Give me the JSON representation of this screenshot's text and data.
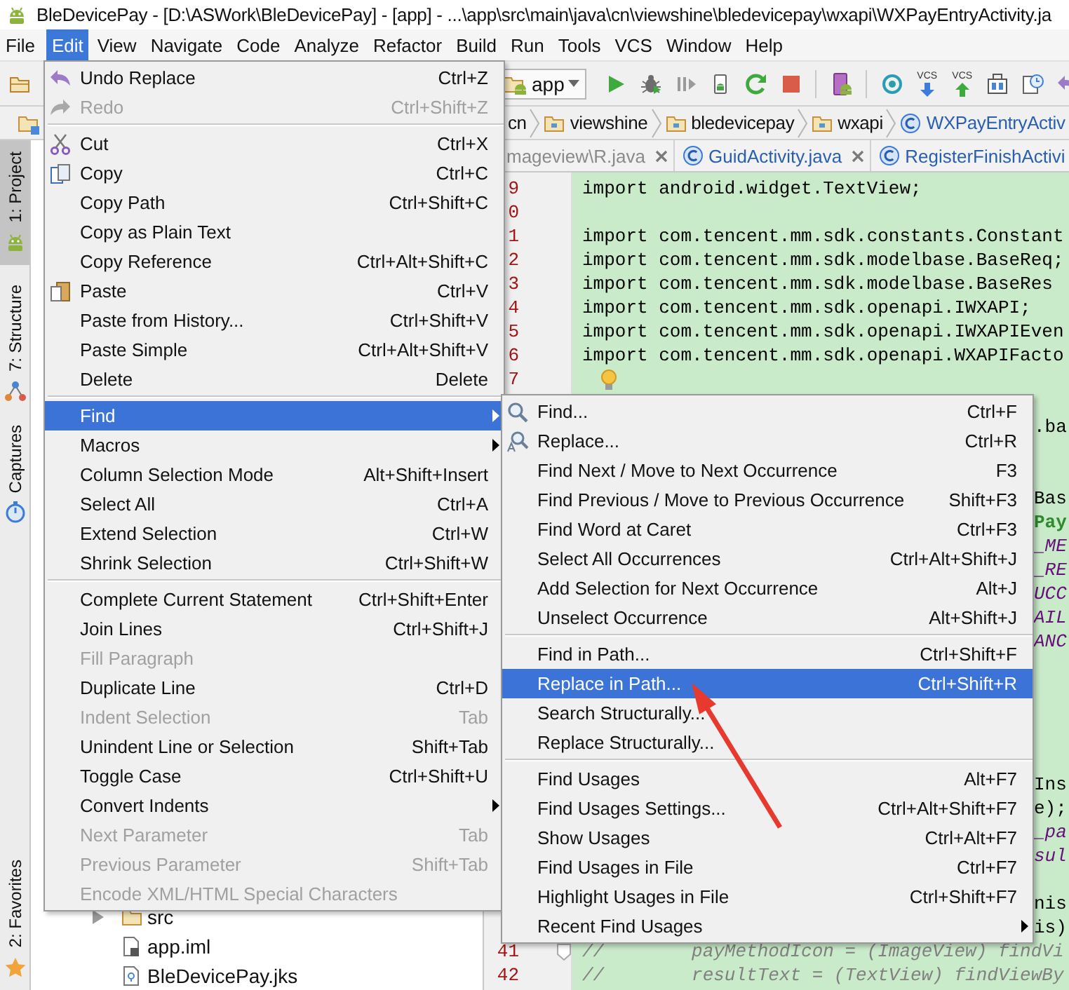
{
  "window": {
    "title": "BleDevicePay - [D:\\ASWork\\BleDevicePay] - [app] - ...\\app\\src\\main\\java\\cn\\viewshine\\bledevicepay\\wxapi\\WXPayEntryActivity.ja"
  },
  "menu_bar": [
    {
      "label": "File",
      "selected": false
    },
    {
      "label": "Edit",
      "selected": true
    },
    {
      "label": "View",
      "selected": false
    },
    {
      "label": "Navigate",
      "selected": false
    },
    {
      "label": "Code",
      "selected": false
    },
    {
      "label": "Analyze",
      "selected": false
    },
    {
      "label": "Refactor",
      "selected": false
    },
    {
      "label": "Build",
      "selected": false
    },
    {
      "label": "Run",
      "selected": false
    },
    {
      "label": "Tools",
      "selected": false
    },
    {
      "label": "VCS",
      "selected": false
    },
    {
      "label": "Window",
      "selected": false
    },
    {
      "label": "Help",
      "selected": false
    }
  ],
  "toolbar": {
    "run_config": "app",
    "buttons": [
      {
        "kind": "run"
      },
      {
        "kind": "debug"
      },
      {
        "kind": "attach"
      },
      {
        "kind": "apply"
      },
      {
        "kind": "rerun"
      },
      {
        "kind": "stop"
      },
      {
        "kind": "separator"
      },
      {
        "kind": "avd"
      },
      {
        "kind": "separator"
      },
      {
        "kind": "sdk"
      },
      {
        "kind": "vcs-update",
        "caption": "VCS"
      },
      {
        "kind": "vcs-commit",
        "caption": "VCS"
      },
      {
        "kind": "compare"
      },
      {
        "kind": "history"
      },
      {
        "kind": "undo"
      }
    ]
  },
  "navigation_bar": [
    {
      "label": "cn",
      "kind": "package"
    },
    {
      "label": "viewshine",
      "kind": "package"
    },
    {
      "label": "bledevicepay",
      "kind": "package"
    },
    {
      "label": "wxapi",
      "kind": "package"
    },
    {
      "label": "WXPayEntryActiv",
      "kind": "class"
    }
  ],
  "editor_tabs": [
    {
      "label": "mageview\\R.java",
      "kind": "generated",
      "closable": true
    },
    {
      "label": "GuidActivity.java",
      "kind": "class",
      "closable": true
    },
    {
      "label": "RegisterFinishActivi",
      "kind": "class",
      "closable": false
    }
  ],
  "tool_windows": [
    {
      "label": "1: Project",
      "kind": "android",
      "selected": true
    },
    {
      "label": "7: Structure",
      "kind": "structure",
      "selected": false
    },
    {
      "label": "Captures",
      "kind": "captures",
      "selected": false
    },
    {
      "label": "2: Favorites",
      "kind": "star",
      "selected": false
    }
  ],
  "project_tree": [
    {
      "label": "src",
      "kind": "folder",
      "expanded": false
    },
    {
      "label": "app.iml",
      "kind": "module-file"
    },
    {
      "label": "BleDevicePay.jks",
      "kind": "keystore"
    }
  ],
  "editor": {
    "lines": [
      {
        "kind": "code",
        "number": "9",
        "code": "import android.widget.TextView;"
      },
      {
        "kind": "code",
        "number": "0"
      },
      {
        "kind": "code",
        "number": "1",
        "code": "import com.tencent.mm.sdk.constants.Constant"
      },
      {
        "kind": "code",
        "number": "2",
        "code": "import com.tencent.mm.sdk.modelbase.BaseReq;"
      },
      {
        "kind": "code",
        "number": "3",
        "code": "import com.tencent.mm.sdk.modelbase.BaseRes"
      },
      {
        "kind": "code",
        "number": "4",
        "code": "import com.tencent.mm.sdk.openapi.IWXAPI;"
      },
      {
        "kind": "code",
        "number": "5",
        "code": "import com.tencent.mm.sdk.openapi.IWXAPIEven"
      },
      {
        "kind": "code",
        "number": "6",
        "code": "import com.tencent.mm.sdk.openapi.WXAPIFacto"
      },
      {
        "kind": "code",
        "number": "7",
        "bulb": true
      },
      {
        "kind": "hidden"
      },
      {
        "kind": "plain",
        "code": ".ba"
      },
      {
        "kind": "hidden"
      },
      {
        "kind": "hidden"
      },
      {
        "kind": "plain",
        "code": "Bas"
      },
      {
        "kind": "string",
        "code": "Pay"
      },
      {
        "kind": "constant",
        "code": "_ME"
      },
      {
        "kind": "constant",
        "code": "_RE"
      },
      {
        "kind": "constant",
        "code": "UCC"
      },
      {
        "kind": "constant",
        "code": "AIL"
      },
      {
        "kind": "constant",
        "code": "ANC"
      },
      {
        "kind": "hidden"
      },
      {
        "kind": "hidden"
      },
      {
        "kind": "hidden"
      },
      {
        "kind": "hidden"
      },
      {
        "kind": "hidden"
      },
      {
        "kind": "plain",
        "code": "Ins"
      },
      {
        "kind": "plain",
        "code": "e);"
      },
      {
        "kind": "constant",
        "code": "_pa"
      },
      {
        "kind": "constant",
        "code": "sul"
      },
      {
        "kind": "hidden"
      },
      {
        "kind": "plain",
        "code": "nis"
      },
      {
        "kind": "plain",
        "code": "is)"
      },
      {
        "kind": "comment",
        "number": "41",
        "code": "//        payMethodIcon = (ImageView) findVi",
        "fold": true
      },
      {
        "kind": "comment",
        "number": "42",
        "code": "//        resultText = (TextView) findViewBy"
      }
    ]
  },
  "edit_menu": [
    {
      "kind": "undo",
      "label": "Undo Replace",
      "shortcut": "Ctrl+Z",
      "disabled": false,
      "selected": false,
      "submenu": false
    },
    {
      "kind": "redo",
      "label": "Redo",
      "shortcut": "Ctrl+Shift+Z",
      "disabled": true,
      "selected": false,
      "submenu": false
    },
    {
      "kind": "separator"
    },
    {
      "kind": "cut",
      "label": "Cut",
      "shortcut": "Ctrl+X",
      "disabled": false,
      "selected": false,
      "submenu": false
    },
    {
      "kind": "copy",
      "label": "Copy",
      "shortcut": "Ctrl+C",
      "disabled": false,
      "selected": false,
      "submenu": false
    },
    {
      "kind": "item",
      "label": "Copy Path",
      "shortcut": "Ctrl+Shift+C",
      "disabled": false,
      "selected": false,
      "submenu": false
    },
    {
      "kind": "item",
      "label": "Copy as Plain Text",
      "disabled": false,
      "selected": false,
      "submenu": false
    },
    {
      "kind": "item",
      "label": "Copy Reference",
      "shortcut": "Ctrl+Alt+Shift+C",
      "disabled": false,
      "selected": false,
      "submenu": false
    },
    {
      "kind": "paste",
      "label": "Paste",
      "shortcut": "Ctrl+V",
      "disabled": false,
      "selected": false,
      "submenu": false
    },
    {
      "kind": "item",
      "label": "Paste from History...",
      "shortcut": "Ctrl+Shift+V",
      "disabled": false,
      "selected": false,
      "submenu": false
    },
    {
      "kind": "item",
      "label": "Paste Simple",
      "shortcut": "Ctrl+Alt+Shift+V",
      "disabled": false,
      "selected": false,
      "submenu": false
    },
    {
      "kind": "item",
      "label": "Delete",
      "shortcut": "Delete",
      "disabled": false,
      "selected": false,
      "submenu": false
    },
    {
      "kind": "separator"
    },
    {
      "kind": "item",
      "label": "Find",
      "disabled": false,
      "selected": true,
      "submenu": true
    },
    {
      "kind": "item",
      "label": "Macros",
      "disabled": false,
      "selected": false,
      "submenu": true
    },
    {
      "kind": "item",
      "label": "Column Selection Mode",
      "shortcut": "Alt+Shift+Insert",
      "disabled": false,
      "selected": false,
      "submenu": false
    },
    {
      "kind": "item",
      "label": "Select All",
      "shortcut": "Ctrl+A",
      "disabled": false,
      "selected": false,
      "submenu": false
    },
    {
      "kind": "item",
      "label": "Extend Selection",
      "shortcut": "Ctrl+W",
      "disabled": false,
      "selected": false,
      "submenu": false
    },
    {
      "kind": "item",
      "label": "Shrink Selection",
      "shortcut": "Ctrl+Shift+W",
      "disabled": false,
      "selected": false,
      "submenu": false
    },
    {
      "kind": "separator"
    },
    {
      "kind": "item",
      "label": "Complete Current Statement",
      "shortcut": "Ctrl+Shift+Enter",
      "disabled": false,
      "selected": false,
      "submenu": false
    },
    {
      "kind": "item",
      "label": "Join Lines",
      "shortcut": "Ctrl+Shift+J",
      "disabled": false,
      "selected": false,
      "submenu": false
    },
    {
      "kind": "item",
      "label": "Fill Paragraph",
      "disabled": true,
      "selected": false,
      "submenu": false
    },
    {
      "kind": "item",
      "label": "Duplicate Line",
      "shortcut": "Ctrl+D",
      "disabled": false,
      "selected": false,
      "submenu": false
    },
    {
      "kind": "item",
      "label": "Indent Selection",
      "shortcut": "Tab",
      "disabled": true,
      "selected": false,
      "submenu": false
    },
    {
      "kind": "item",
      "label": "Unindent Line or Selection",
      "shortcut": "Shift+Tab",
      "disabled": false,
      "selected": false,
      "submenu": false
    },
    {
      "kind": "item",
      "label": "Toggle Case",
      "shortcut": "Ctrl+Shift+U",
      "disabled": false,
      "selected": false,
      "submenu": false
    },
    {
      "kind": "item",
      "label": "Convert Indents",
      "disabled": false,
      "selected": false,
      "submenu": true
    },
    {
      "kind": "item",
      "label": "Next Parameter",
      "shortcut": "Tab",
      "disabled": true,
      "selected": false,
      "submenu": false
    },
    {
      "kind": "item",
      "label": "Previous Parameter",
      "shortcut": "Shift+Tab",
      "disabled": true,
      "selected": false,
      "submenu": false
    },
    {
      "kind": "item",
      "label": "Encode XML/HTML Special Characters",
      "disabled": true,
      "selected": false,
      "submenu": false
    }
  ],
  "find_submenu": [
    {
      "kind": "search",
      "label": "Find...",
      "shortcut": "Ctrl+F",
      "disabled": false,
      "selected": false,
      "submenu": false
    },
    {
      "kind": "replace",
      "label": "Replace...",
      "shortcut": "Ctrl+R",
      "disabled": false,
      "selected": false,
      "submenu": false
    },
    {
      "kind": "item",
      "label": "Find Next / Move to Next Occurrence",
      "shortcut": "F3",
      "disabled": false,
      "selected": false,
      "submenu": false
    },
    {
      "kind": "item",
      "label": "Find Previous / Move to Previous Occurrence",
      "shortcut": "Shift+F3",
      "disabled": false,
      "selected": false,
      "submenu": false
    },
    {
      "kind": "item",
      "label": "Find Word at Caret",
      "shortcut": "Ctrl+F3",
      "disabled": false,
      "selected": false,
      "submenu": false
    },
    {
      "kind": "item",
      "label": "Select All Occurrences",
      "shortcut": "Ctrl+Alt+Shift+J",
      "disabled": false,
      "selected": false,
      "submenu": false
    },
    {
      "kind": "item",
      "label": "Add Selection for Next Occurrence",
      "shortcut": "Alt+J",
      "disabled": false,
      "selected": false,
      "submenu": false
    },
    {
      "kind": "item",
      "label": "Unselect Occurrence",
      "shortcut": "Alt+Shift+J",
      "disabled": false,
      "selected": false,
      "submenu": false
    },
    {
      "kind": "separator"
    },
    {
      "kind": "item",
      "label": "Find in Path...",
      "shortcut": "Ctrl+Shift+F",
      "disabled": false,
      "selected": false,
      "submenu": false
    },
    {
      "kind": "item",
      "label": "Replace in Path...",
      "shortcut": "Ctrl+Shift+R",
      "disabled": false,
      "selected": true,
      "submenu": false
    },
    {
      "kind": "item",
      "label": "Search Structurally...",
      "disabled": false,
      "selected": false,
      "submenu": false
    },
    {
      "kind": "item",
      "label": "Replace Structurally...",
      "disabled": false,
      "selected": false,
      "submenu": false
    },
    {
      "kind": "separator"
    },
    {
      "kind": "item",
      "label": "Find Usages",
      "shortcut": "Alt+F7",
      "disabled": false,
      "selected": false,
      "submenu": false
    },
    {
      "kind": "item",
      "label": "Find Usages Settings...",
      "shortcut": "Ctrl+Alt+Shift+F7",
      "disabled": false,
      "selected": false,
      "submenu": false
    },
    {
      "kind": "item",
      "label": "Show Usages",
      "shortcut": "Ctrl+Alt+F7",
      "disabled": false,
      "selected": false,
      "submenu": false
    },
    {
      "kind": "item",
      "label": "Find Usages in File",
      "shortcut": "Ctrl+F7",
      "disabled": false,
      "selected": false,
      "submenu": false
    },
    {
      "kind": "item",
      "label": "Highlight Usages in File",
      "shortcut": "Ctrl+Shift+F7",
      "disabled": false,
      "selected": false,
      "submenu": false
    },
    {
      "kind": "item",
      "label": "Recent Find Usages",
      "disabled": false,
      "selected": false,
      "submenu": true
    }
  ]
}
